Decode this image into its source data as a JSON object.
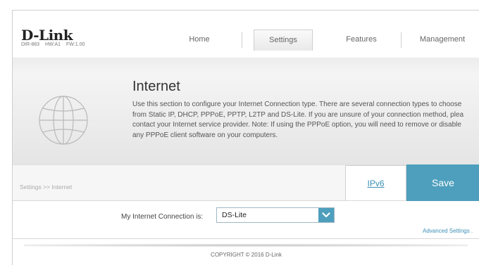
{
  "header": {
    "logo": "D-Link",
    "model": "DIR-883",
    "hw": "HW:A1",
    "fw": "FW:1.00",
    "nav": {
      "home": "Home",
      "settings": "Settings",
      "features": "Features",
      "management": "Management"
    }
  },
  "banner": {
    "title": "Internet",
    "description": [
      "Use this section to configure your Internet Connection type. There are several connection types to choose",
      "from Static IP, DHCP, PPPoE, PPTP, L2TP and DS-Lite. If you are unsure of your connection method, plea",
      "contact your Internet service provider. Note: If using the PPPoE option, you will need to remove or disable",
      "any PPPoE client software on your computers."
    ]
  },
  "breadcrumb": "Settings >> Internet",
  "actions": {
    "ipv6": "IPv6",
    "save": "Save"
  },
  "form": {
    "connection_label": "My Internet Connection is:",
    "connection_value": "DS-Lite",
    "advanced_link": "Advanced Settings ."
  },
  "footer": {
    "copyright": "COPYRIGHT © 2016 D-Link"
  },
  "colors": {
    "accent": "#4d9fbd",
    "link": "#3a8fb5"
  },
  "icons": {
    "globe": "globe-icon",
    "dropdown": "chevron-down-icon"
  }
}
